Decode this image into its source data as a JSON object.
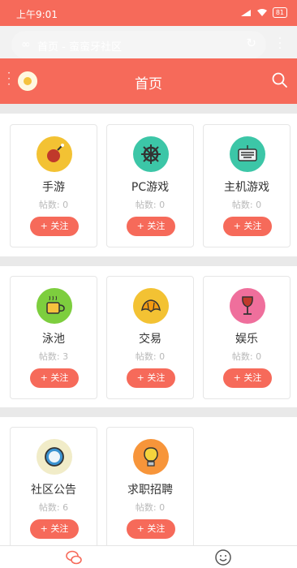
{
  "status_bar": {
    "time": "上午9:01",
    "battery": "81"
  },
  "browser": {
    "url_title": "首页 - 蛮蛮牙社区"
  },
  "nav": {
    "title": "首页"
  },
  "forums": [
    {
      "name": "手游",
      "count": "帖数: 0",
      "follow": "+ 关注",
      "icon": "bomb-icon",
      "color": "#f3c233"
    },
    {
      "name": "PC游戏",
      "count": "帖数: 0",
      "follow": "+ 关注",
      "icon": "ship-wheel-icon",
      "color": "#3cc6a7"
    },
    {
      "name": "主机游戏",
      "count": "帖数: 0",
      "follow": "+ 关注",
      "icon": "keyboard-icon",
      "color": "#3cc6a7"
    },
    {
      "name": "泳池",
      "count": "帖数: 3",
      "follow": "+ 关注",
      "icon": "mug-icon",
      "color": "#7dce3e"
    },
    {
      "name": "交易",
      "count": "帖数: 0",
      "follow": "+ 关注",
      "icon": "croissant-icon",
      "color": "#f3c233"
    },
    {
      "name": "娱乐",
      "count": "帖数: 0",
      "follow": "+ 关注",
      "icon": "wine-icon",
      "color": "#ef6f9c"
    },
    {
      "name": "社区公告",
      "count": "帖数: 6",
      "follow": "+ 关注",
      "icon": "clock-icon",
      "color": "#f1ecc8"
    },
    {
      "name": "求职招聘",
      "count": "帖数: 0",
      "follow": "+ 关注",
      "icon": "lightbulb-icon",
      "color": "#f7953a"
    }
  ],
  "colors": {
    "accent": "#f66a5a",
    "page_bg": "#f2f2f2"
  }
}
